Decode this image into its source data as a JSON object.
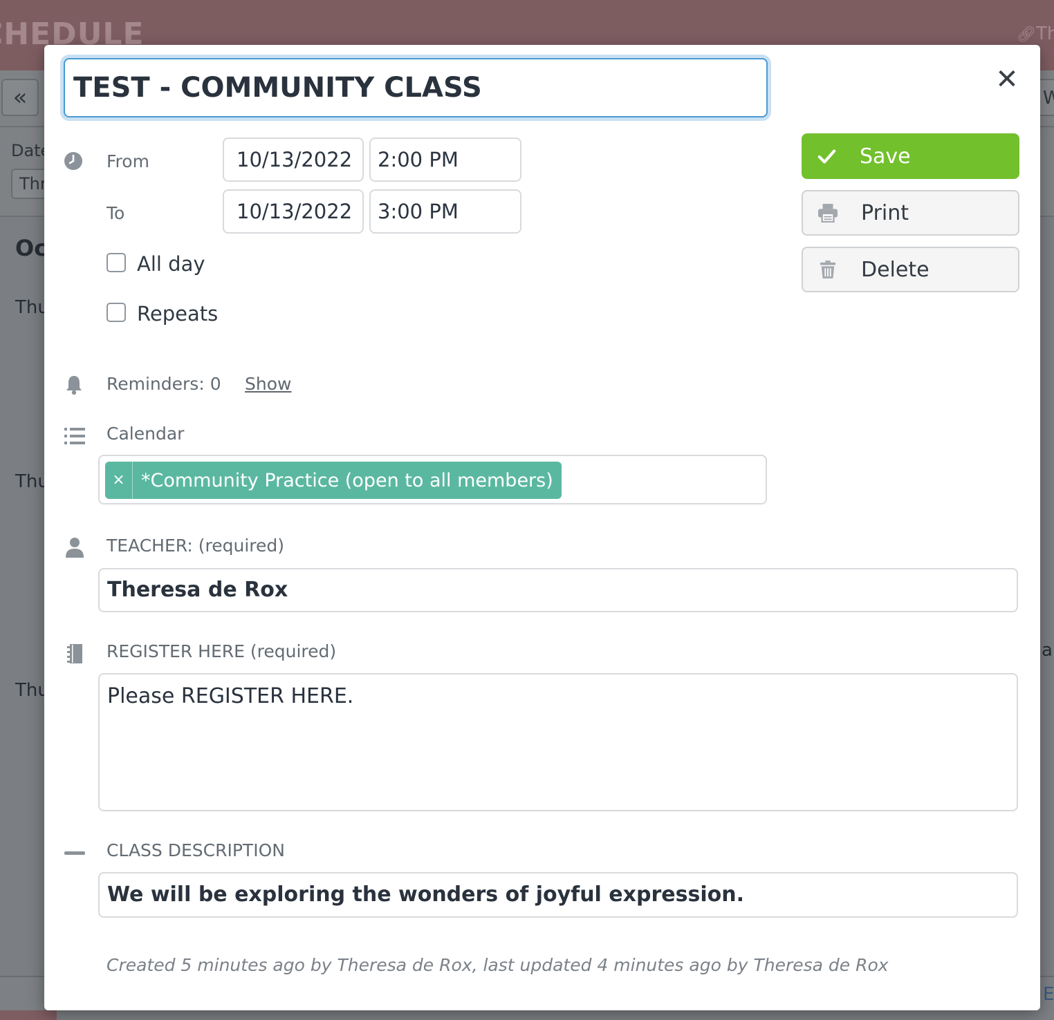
{
  "background": {
    "app_title": "CHEDULE",
    "link_text": "Th",
    "prev_icon": "double-chevron-left-icon",
    "week_button_partial": "We",
    "date_label": "Date",
    "date_select_partial": "Thr",
    "month_partial": "Oc",
    "day_partials": [
      "Thu",
      "Thu",
      "Thu"
    ],
    "right_partial": "a",
    "bottom_right_partial": "E"
  },
  "modal": {
    "title": "TEST - COMMUNITY CLASS",
    "close_icon": "close-icon",
    "time": {
      "icon": "clock-icon",
      "from_label": "From",
      "from_date": "10/13/2022",
      "from_time": "2:00 PM",
      "to_label": "To",
      "to_date": "10/13/2022",
      "to_time": "3:00 PM"
    },
    "all_day_label": "All day",
    "repeats_label": "Repeats",
    "reminders": {
      "icon": "bell-icon",
      "text": "Reminders: 0",
      "link": "Show"
    },
    "calendar": {
      "icon": "list-icon",
      "label": "Calendar",
      "tag_remove": "×",
      "tag": "*Community Practice (open to all members)",
      "tag_color": "#5bb8a0"
    },
    "teacher": {
      "icon": "person-icon",
      "label": "TEACHER: (required)",
      "value": "Theresa de Rox"
    },
    "register": {
      "icon": "notebook-icon",
      "label": "REGISTER HERE (required)",
      "value": "Please REGISTER HERE."
    },
    "description": {
      "icon": "dash-icon",
      "label": "CLASS DESCRIPTION",
      "value": "We will be exploring the wonders of joyful expression."
    },
    "buttons": {
      "save": "Save",
      "save_icon": "checkmark-icon",
      "save_color": "#72c02c",
      "print": "Print",
      "print_icon": "printer-icon",
      "delete": "Delete",
      "delete_icon": "trash-icon"
    },
    "meta": "Created 5 minutes ago by Theresa de Rox, last updated 4 minutes ago by Theresa de Rox"
  }
}
